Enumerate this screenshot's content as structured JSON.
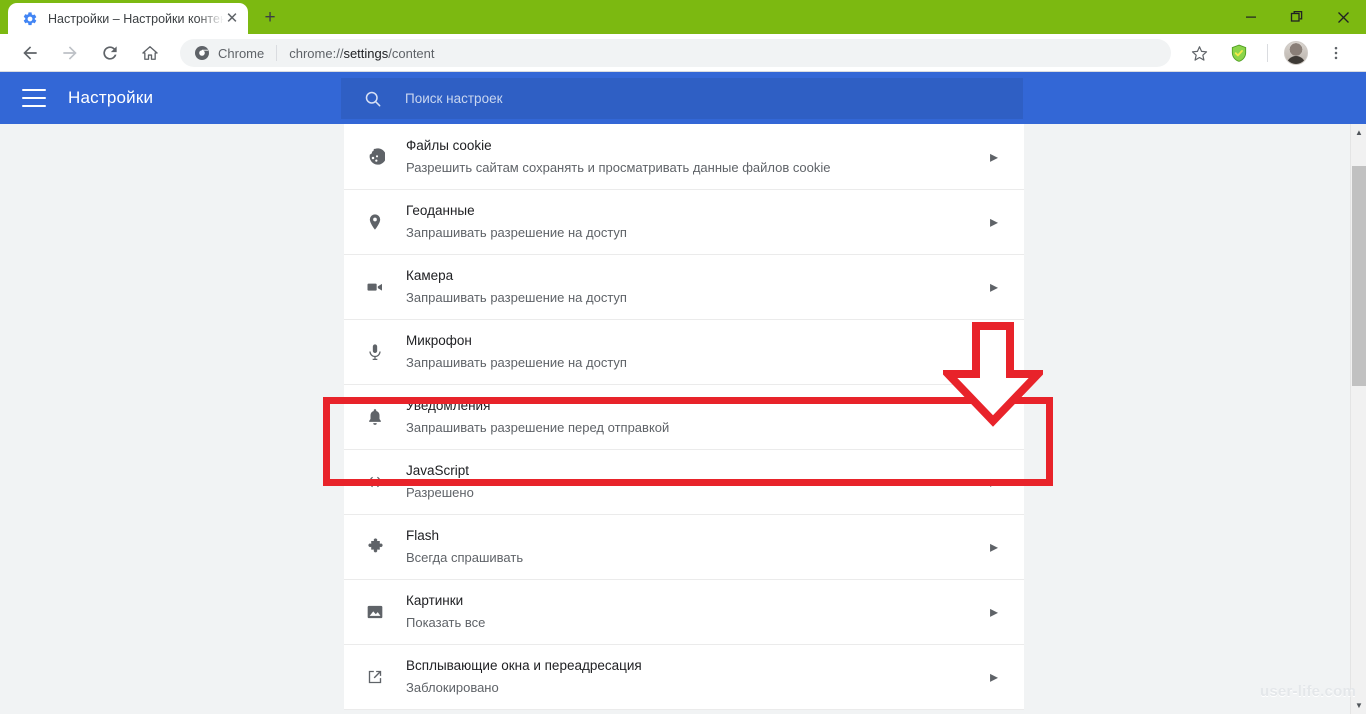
{
  "window": {
    "background_color": "#7CB911",
    "controls": {
      "minimize_label": "—",
      "maximize_label": "❐",
      "close_label": "✕"
    }
  },
  "tab": {
    "favicon": "gear-icon",
    "title": "Настройки – Настройки контента",
    "close_label": "✕",
    "new_tab_label": "+"
  },
  "toolbar": {
    "back_icon": "back-arrow-icon",
    "forward_icon": "forward-arrow-icon",
    "reload_icon": "reload-icon",
    "home_icon": "home-icon",
    "omnibox": {
      "chip_icon": "chrome-logo-icon",
      "chip_label": "Chrome",
      "url_prefix": "chrome://",
      "url_strong": "settings",
      "url_suffix": "/content"
    },
    "bookmark_icon": "star-icon",
    "extension_icon": "green-shield-icon",
    "profile_icon": "avatar",
    "menu_icon": "three-dot-menu-icon"
  },
  "settings_header": {
    "menu_icon": "hamburger-menu-icon",
    "title": "Настройки",
    "accent_color": "#3367d6",
    "search": {
      "icon": "search-icon",
      "placeholder": "Поиск настроек",
      "value": ""
    }
  },
  "content_settings": {
    "chevron": "▸",
    "rows": [
      {
        "icon": "cookie-icon",
        "title": "Файлы cookie",
        "subtitle": "Разрешить сайтам сохранять и просматривать данные файлов cookie"
      },
      {
        "icon": "location-pin-icon",
        "title": "Геоданные",
        "subtitle": "Запрашивать разрешение на доступ"
      },
      {
        "icon": "camera-icon",
        "title": "Камера",
        "subtitle": "Запрашивать разрешение на доступ"
      },
      {
        "icon": "microphone-icon",
        "title": "Микрофон",
        "subtitle": "Запрашивать разрешение на доступ"
      },
      {
        "icon": "bell-icon",
        "title": "Уведомления",
        "subtitle": "Запрашивать разрешение перед отправкой"
      },
      {
        "icon": "code-brackets-icon",
        "title": "JavaScript",
        "subtitle": "Разрешено"
      },
      {
        "icon": "puzzle-piece-icon",
        "title": "Flash",
        "subtitle": "Всегда спрашивать"
      },
      {
        "icon": "image-icon",
        "title": "Картинки",
        "subtitle": "Показать все"
      },
      {
        "icon": "popup-window-icon",
        "title": "Всплывающие окна и переадресация",
        "subtitle": "Заблокировано"
      }
    ]
  },
  "annotations": {
    "highlight_color": "#e8232a",
    "highlight_target": "Уведомления",
    "arrow_direction": "down"
  },
  "scrollbar": {
    "up_arrow": "▲",
    "down_arrow": "▼"
  },
  "watermark": {
    "text": "user-life.com"
  }
}
